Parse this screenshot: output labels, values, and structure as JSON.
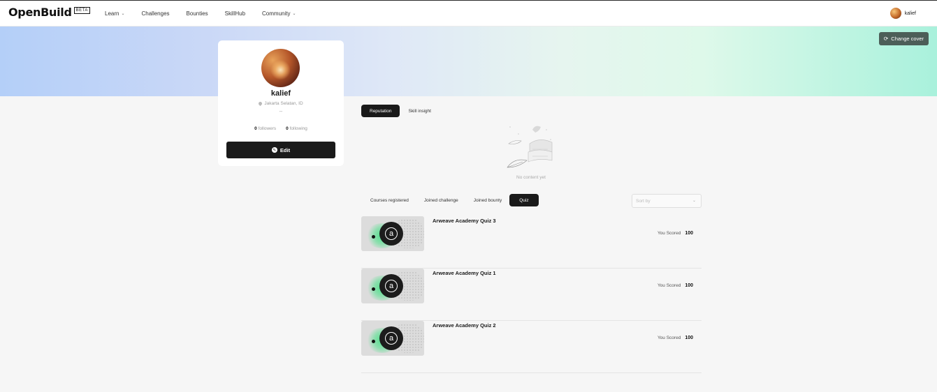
{
  "nav": {
    "logo_text": "OpenBuild",
    "logo_badge": "BETA",
    "links": [
      {
        "label": "Learn",
        "dropdown": true
      },
      {
        "label": "Challenges",
        "dropdown": false
      },
      {
        "label": "Bounties",
        "dropdown": false
      },
      {
        "label": "SkillHub",
        "dropdown": false
      },
      {
        "label": "Community",
        "dropdown": true
      }
    ],
    "username": "kalief",
    "chevron_glyph": "⌄"
  },
  "cover": {
    "change_cover_label": "Change cover"
  },
  "profile": {
    "name": "kalief",
    "location": "Jakarta Selatan, ID",
    "bio": "--",
    "followers_count": "0",
    "followers_label": "followers",
    "following_count": "0",
    "following_label": "following",
    "edit_label": "Edit"
  },
  "top_tabs": [
    {
      "label": "Reputation",
      "active": true
    },
    {
      "label": "Skill insight",
      "active": false
    }
  ],
  "empty_state": {
    "text": "No content yet"
  },
  "sub_tabs": [
    {
      "label": "Courses registered",
      "active": false
    },
    {
      "label": "Joined challenge",
      "active": false
    },
    {
      "label": "Joined bounty",
      "active": false
    },
    {
      "label": "Quiz",
      "active": true
    }
  ],
  "sort": {
    "placeholder": "Sort by"
  },
  "quizzes": [
    {
      "title": "Arweave Academy Quiz 3",
      "score_label": "You Scored",
      "score": "100",
      "logo_glyph": "a"
    },
    {
      "title": "Arweave Academy Quiz 1",
      "score_label": "You Scored",
      "score": "100",
      "logo_glyph": "a"
    },
    {
      "title": "Arweave Academy Quiz 2",
      "score_label": "You Scored",
      "score": "100",
      "logo_glyph": "a"
    }
  ],
  "colors": {
    "accent_dark": "#1a1a1a",
    "cover_button": "#4c5e58",
    "thumb_glow": "#4ee08a"
  }
}
